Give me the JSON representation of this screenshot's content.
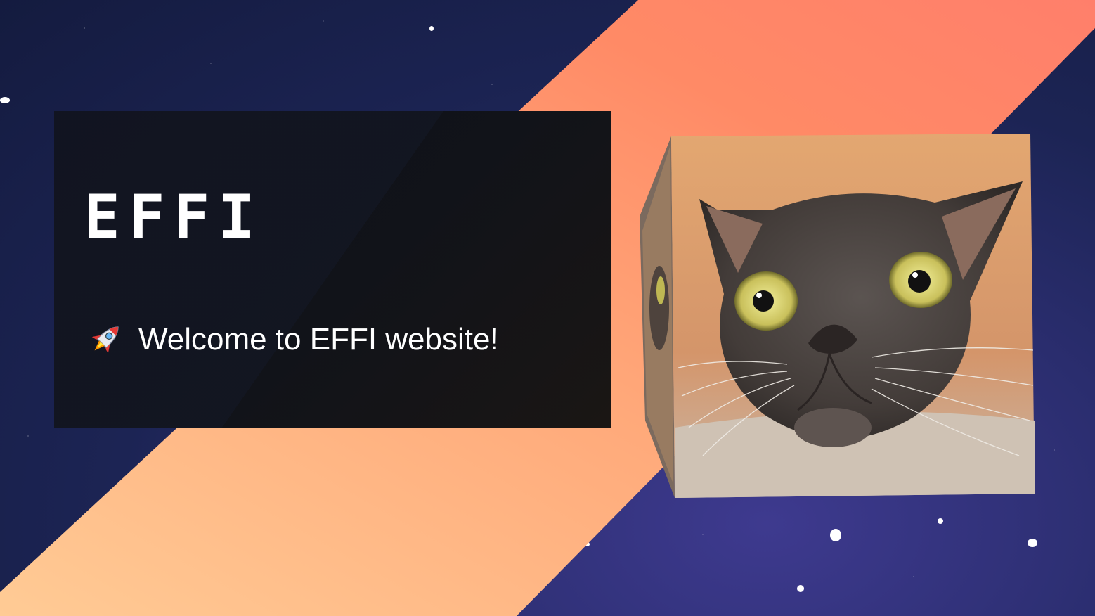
{
  "hero": {
    "title": "EFFI",
    "welcome_text": "Welcome to EFFI website!",
    "welcome_icon": "rocket-icon"
  },
  "cube": {
    "subject": "cat-face-image"
  },
  "colors": {
    "space_dark": "#141b3f",
    "space_mid": "#2a2d6e",
    "band_orange": "#ff8a65",
    "band_peach": "#ffc48f",
    "card_bg": "#111319",
    "text": "#ffffff"
  }
}
